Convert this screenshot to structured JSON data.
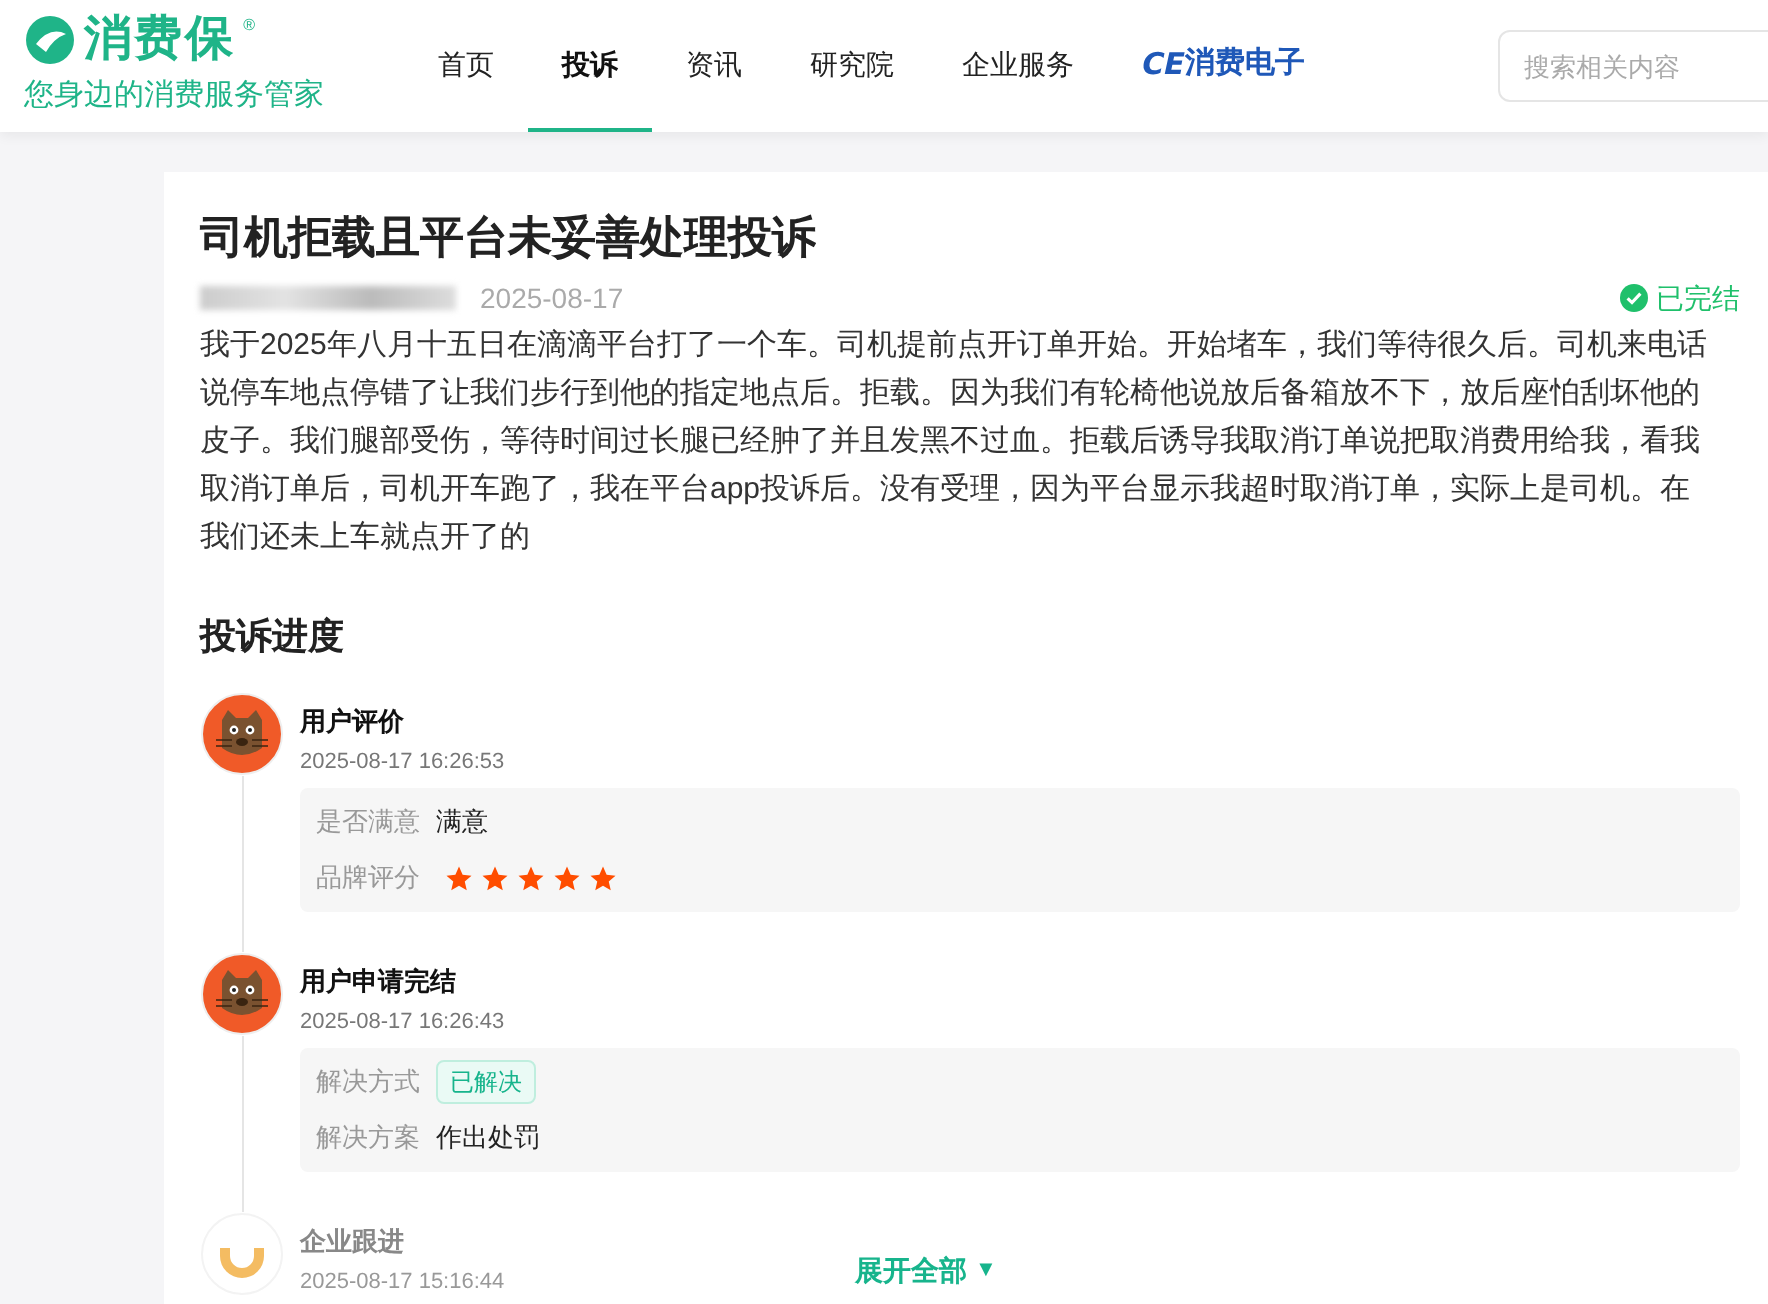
{
  "logo": {
    "name": "消费保",
    "mark": "®",
    "slogan": "您身边的消费服务管家"
  },
  "nav": [
    {
      "label": "首页",
      "selected": false,
      "kind": "text"
    },
    {
      "label": "投诉",
      "selected": true,
      "kind": "text"
    },
    {
      "label": "资讯",
      "selected": false,
      "kind": "text"
    },
    {
      "label": "研究院",
      "selected": false,
      "kind": "text"
    },
    {
      "label": "企业服务",
      "selected": false,
      "kind": "text"
    },
    {
      "label": "消费电子",
      "badge": "CE",
      "selected": false,
      "kind": "brand"
    }
  ],
  "search": {
    "placeholder": "搜索相关内容"
  },
  "complaint": {
    "title": "司机拒载且平台未妥善处理投诉",
    "date": "2025-08-17",
    "status": {
      "label": "已完结",
      "done": true
    },
    "body": "我于2025年八月十五日在滴滴平台打了一个车。司机提前点开订单开始。开始堵车，我们等待很久后。司机来电话说停车地点停错了让我们步行到他的指定地点后。拒载。因为我们有轮椅他说放后备箱放不下，放后座怕刮坏他的皮子。我们腿部受伤，等待时间过长腿已经肿了并且发黑不过血。拒载后诱导我取消订单说把取消费用给我，看我取消订单后，司机开车跑了，我在平台app投诉后。没有受理，因为平台显示我超时取消订单，实际上是司机。在我们还未上车就点开了的"
  },
  "progress": {
    "title": "投诉进度",
    "events": [
      {
        "kind": "user",
        "title": "用户评价",
        "time": "2025-08-17 16:26:53",
        "fields": [
          {
            "kind": "text",
            "label": "是否满意",
            "value": "满意"
          },
          {
            "kind": "stars",
            "label": "品牌评分",
            "stars": 5
          }
        ]
      },
      {
        "kind": "user",
        "title": "用户申请完结",
        "time": "2025-08-17 16:26:43",
        "fields": [
          {
            "kind": "tag",
            "label": "解决方式",
            "value": "已解决"
          },
          {
            "kind": "text",
            "label": "解决方案",
            "value": "作出处罚"
          }
        ]
      },
      {
        "kind": "company",
        "title": "企业跟进",
        "time": "2025-08-17 15:16:44"
      }
    ],
    "expand": "展开全部",
    "expand_icon": "▼"
  }
}
